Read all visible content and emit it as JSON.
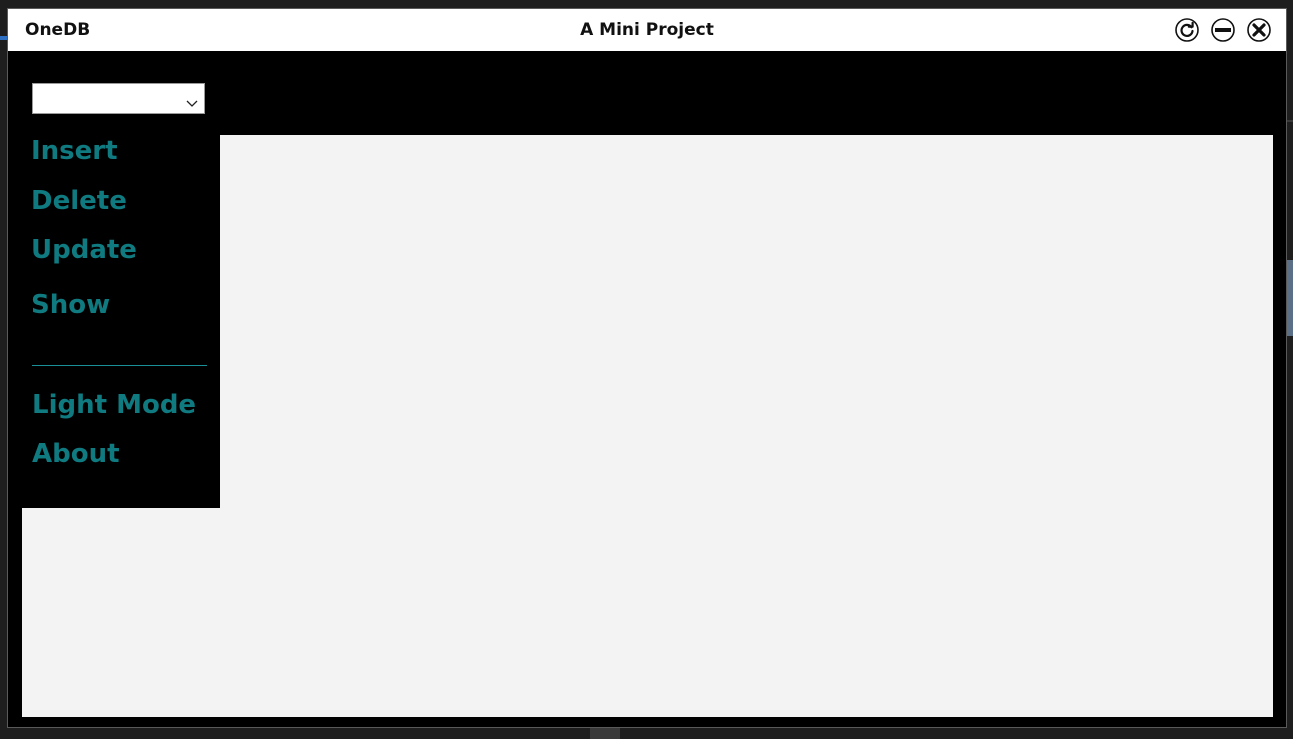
{
  "titlebar": {
    "app_name": "OneDB",
    "title": "A Mini Project",
    "buttons": {
      "refresh": "refresh-icon",
      "minimize": "minimize-icon",
      "close": "close-icon"
    }
  },
  "sidebar": {
    "combo": {
      "value": ""
    },
    "items": [
      {
        "label": "Insert"
      },
      {
        "label": "Delete"
      },
      {
        "label": "Update"
      },
      {
        "label": "Show"
      }
    ],
    "footer_items": [
      {
        "label": "Light Mode"
      },
      {
        "label": "About"
      }
    ]
  },
  "colors": {
    "accent": "#0f7a80",
    "sidebar_bg": "#000000",
    "content_bg": "#f3f3f3",
    "titlebar_bg": "#ffffff"
  }
}
